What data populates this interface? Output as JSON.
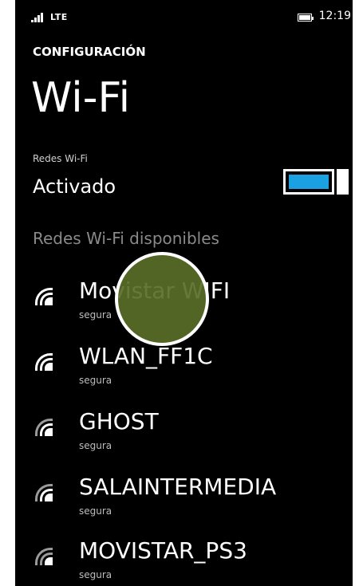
{
  "status_bar": {
    "network_type": "LTE",
    "time": "12:19"
  },
  "header": {
    "app_title": "CONFIGURACIÓN",
    "page_title": "Wi-Fi"
  },
  "wifi_toggle": {
    "label": "Redes Wi-Fi",
    "state": "Activado",
    "on": true,
    "accent_color": "#1ba1e2"
  },
  "networks_section": {
    "heading": "Redes Wi-Fi disponibles",
    "networks": [
      {
        "name": "Movistar WIFI",
        "security": "segura",
        "icon": "wifi-secure-icon"
      },
      {
        "name": "WLAN_FF1C",
        "security": "segura",
        "icon": "wifi-secure-icon"
      },
      {
        "name": "GHOST",
        "security": "segura",
        "icon": "wifi-secure-icon"
      },
      {
        "name": "SALAINTERMEDIA",
        "security": "segura",
        "icon": "wifi-secure-icon"
      },
      {
        "name": "MOVISTAR_PS3",
        "security": "segura",
        "icon": "wifi-secure-icon"
      }
    ]
  },
  "touch_indicator_color": "#5a6e28"
}
